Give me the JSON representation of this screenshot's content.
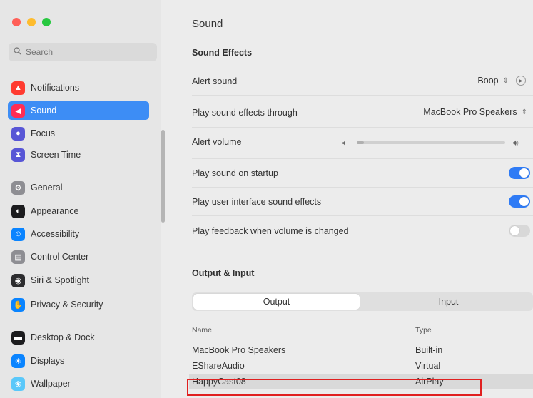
{
  "window": {
    "colors": {
      "accent": "#3d8df5",
      "highlight": "#e02020"
    }
  },
  "sidebar": {
    "search": {
      "placeholder": "Search"
    },
    "items": [
      {
        "label": "Notifications",
        "icon": "bell-icon",
        "color": "#ff3b30"
      },
      {
        "label": "Sound",
        "icon": "speaker-icon",
        "color": "#ff2d55",
        "active": true
      },
      {
        "label": "Focus",
        "icon": "moon-icon",
        "color": "#5856d6"
      },
      {
        "label": "Screen Time",
        "icon": "hourglass-icon",
        "color": "#5856d6"
      },
      {
        "label": "General",
        "icon": "gear-icon",
        "color": "#8e8e93"
      },
      {
        "label": "Appearance",
        "icon": "appearance-icon",
        "color": "#1c1c1e"
      },
      {
        "label": "Accessibility",
        "icon": "accessibility-icon",
        "color": "#0a84ff"
      },
      {
        "label": "Control Center",
        "icon": "control-center-icon",
        "color": "#8e8e93"
      },
      {
        "label": "Siri & Spotlight",
        "icon": "siri-icon",
        "color": "#2c2c2e"
      },
      {
        "label": "Privacy & Security",
        "icon": "hand-icon",
        "color": "#0a84ff"
      },
      {
        "label": "Desktop & Dock",
        "icon": "dock-icon",
        "color": "#1c1c1e"
      },
      {
        "label": "Displays",
        "icon": "display-icon",
        "color": "#0a84ff"
      },
      {
        "label": "Wallpaper",
        "icon": "wallpaper-icon",
        "color": "#5ac8fa"
      }
    ]
  },
  "main": {
    "title": "Sound",
    "sound_effects": {
      "heading": "Sound Effects",
      "alert_sound": {
        "label": "Alert sound",
        "value": "Boop"
      },
      "play_through": {
        "label": "Play sound effects through",
        "value": "MacBook Pro Speakers"
      },
      "alert_volume": {
        "label": "Alert volume",
        "level": 0.05
      },
      "startup": {
        "label": "Play sound on startup",
        "on": true
      },
      "ui_effects": {
        "label": "Play user interface sound effects",
        "on": true
      },
      "feedback": {
        "label": "Play feedback when volume is changed",
        "on": false
      }
    },
    "output_input": {
      "heading": "Output & Input",
      "tabs": [
        {
          "label": "Output",
          "selected": true
        },
        {
          "label": "Input",
          "selected": false
        }
      ],
      "columns": {
        "name": "Name",
        "type": "Type"
      },
      "devices": [
        {
          "name": "MacBook Pro Speakers",
          "type": "Built-in"
        },
        {
          "name": "EShareAudio",
          "type": "Virtual"
        },
        {
          "name": "HappyCast08",
          "type": "AirPlay",
          "selected": true
        }
      ]
    }
  }
}
